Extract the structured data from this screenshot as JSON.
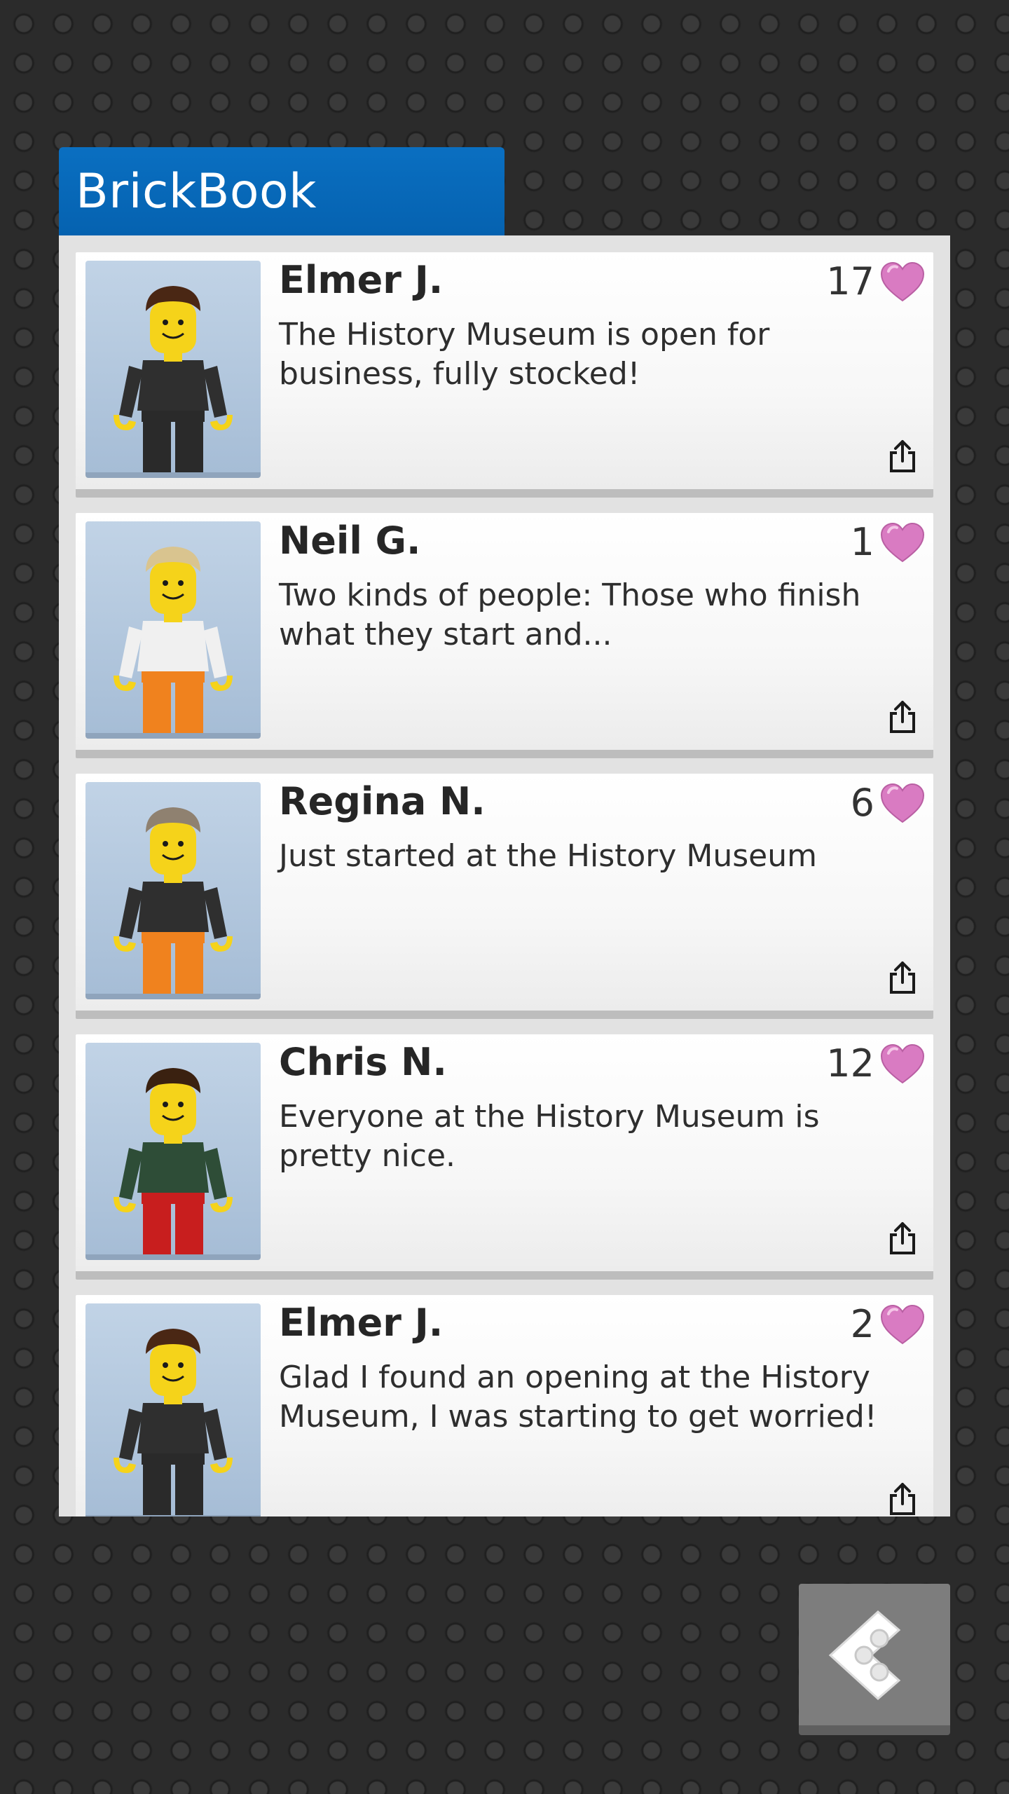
{
  "app": {
    "title": "BrickBook"
  },
  "posts": [
    {
      "author": "Elmer J.",
      "likes": "17",
      "message": "The History Museum is open for business, fully stocked!",
      "avatar": {
        "hair": "#4a2714",
        "torso": "#2f2f2f",
        "legs": "#2a2a2a"
      }
    },
    {
      "author": "Neil G.",
      "likes": "1",
      "message": "Two kinds of people: Those who finish what they start and...",
      "avatar": {
        "hair": "#d9c48f",
        "torso": "#f0f0f0",
        "legs": "#f0821e"
      }
    },
    {
      "author": "Regina N.",
      "likes": "6",
      "message": "Just started at the History Museum",
      "avatar": {
        "hair": "#8f8170",
        "torso": "#2f2f2f",
        "legs": "#f0821e"
      }
    },
    {
      "author": "Chris N.",
      "likes": "12",
      "message": "Everyone at the History Museum is pretty nice.",
      "avatar": {
        "hair": "#3a2110",
        "torso": "#2e4d37",
        "legs": "#c81e1e"
      }
    },
    {
      "author": "Elmer J.",
      "likes": "2",
      "message": "Glad I found an opening at the History Museum, I was starting to get worried!",
      "avatar": {
        "hair": "#4a2714",
        "torso": "#2f2f2f",
        "legs": "#2a2a2a"
      }
    }
  ],
  "icons": {
    "like": "heart-icon",
    "share": "share-icon",
    "back": "back-brick-icon"
  },
  "colors": {
    "brand": "#0a6fc1",
    "heart": "#d97bc2"
  }
}
